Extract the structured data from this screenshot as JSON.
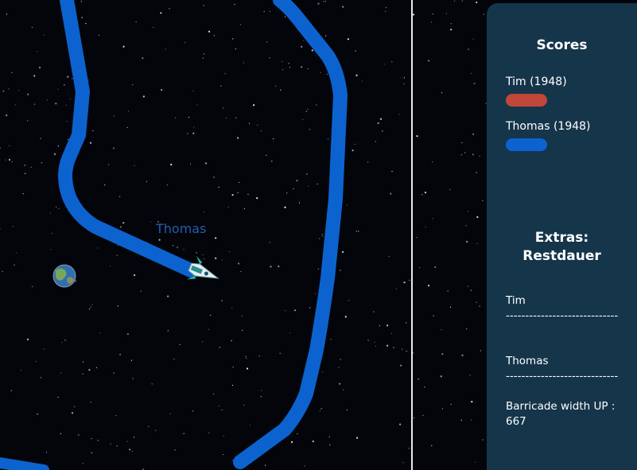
{
  "game": {
    "player_label": "Thomas"
  },
  "scores": {
    "title": "Scores",
    "players": [
      {
        "label": "Tim (1948)",
        "color": "#c0473a"
      },
      {
        "label": "Thomas (1948)",
        "color": "#0c63cf"
      }
    ]
  },
  "extras": {
    "title_line1": "Extras:",
    "title_line2": "Restdauer",
    "entries": [
      {
        "name": "Tim",
        "bar": "-----------------------------"
      },
      {
        "name": "Thomas",
        "bar": "-----------------------------"
      }
    ],
    "barricade": "Barricade width UP : 667"
  },
  "colors": {
    "trail": "#0c63cf",
    "panel": "#15354b",
    "background": "#04050a"
  }
}
